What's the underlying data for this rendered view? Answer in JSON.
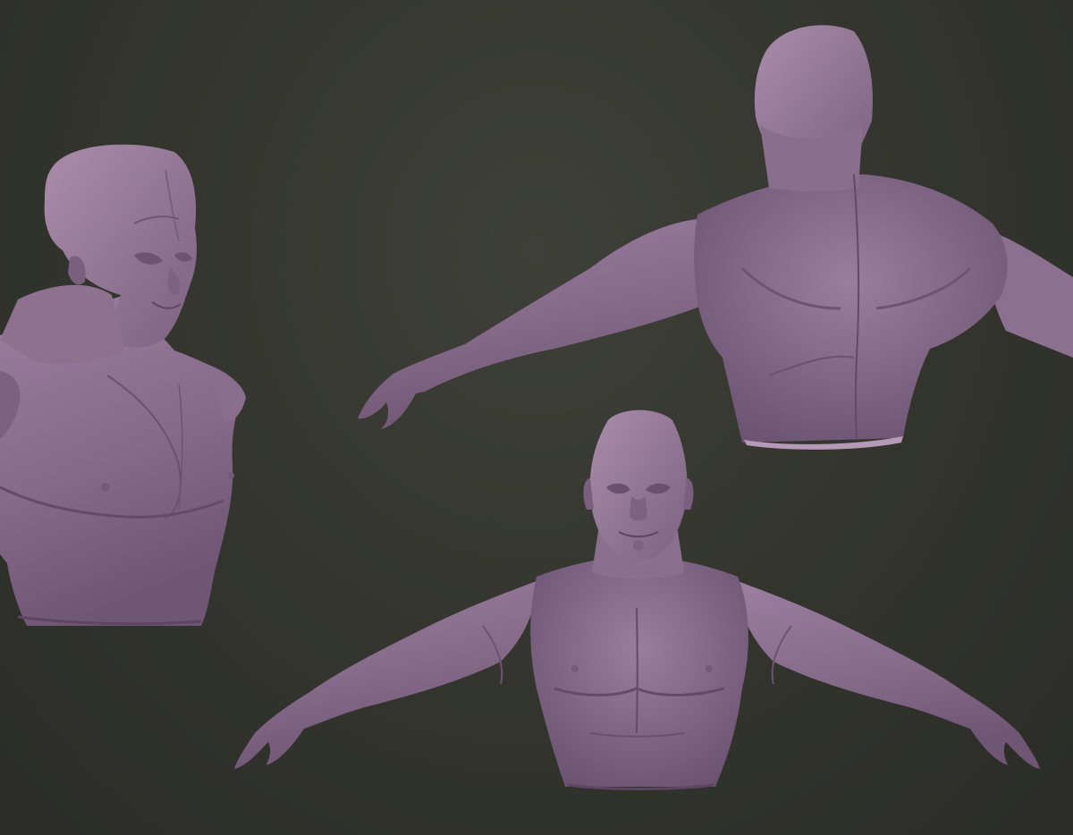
{
  "scene": {
    "background_color": "#35372f",
    "model_color": "#8a6f8f",
    "model_highlight": "#a78aa9",
    "model_shadow": "#5a4560",
    "views": [
      {
        "name": "three-quarter-front"
      },
      {
        "name": "back"
      },
      {
        "name": "front"
      }
    ]
  }
}
